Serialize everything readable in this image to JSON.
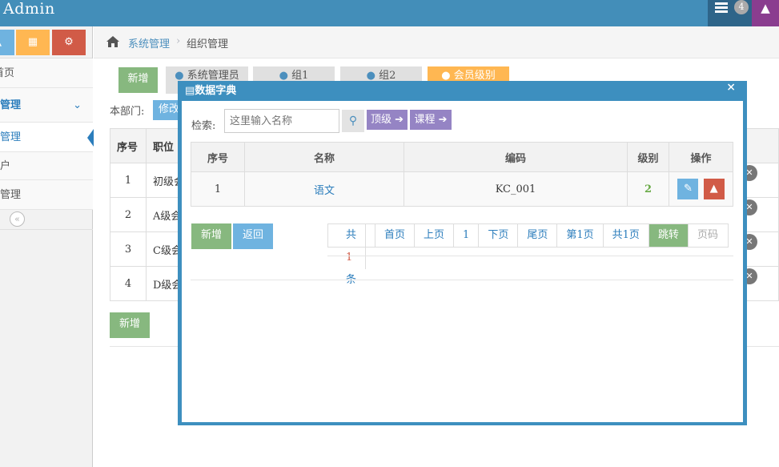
{
  "app": {
    "title": "Admin",
    "notification_count": "4"
  },
  "colors": {
    "navbar": "#438eb9",
    "overlay": "#3d8fbf",
    "green": "#87b87f",
    "blue": "#6fb3e0",
    "red": "#d15b47",
    "purple": "#9584c4",
    "yellow": "#ffb752"
  },
  "sidebar": {
    "shortcut_icons": [
      "chart-icon",
      "book-icon",
      "cogs-icon"
    ],
    "items": [
      {
        "label": "首页"
      },
      {
        "label": "管理"
      },
      {
        "label": "管理"
      },
      {
        "label": "户"
      },
      {
        "label": "管理"
      }
    ]
  },
  "breadcrumb": {
    "root": "系统管理",
    "current": "组织管理"
  },
  "page": {
    "add_label": "新增",
    "tabs": [
      "系统管理员",
      "组1",
      "组2",
      "会员级别"
    ],
    "dept_label": "本部门:",
    "edit_label": "修改",
    "table_headers": [
      "序号",
      "职位"
    ],
    "rows": [
      {
        "no": "1",
        "title": "初级会"
      },
      {
        "no": "2",
        "title": "A级会"
      },
      {
        "no": "3",
        "title": "C级会"
      },
      {
        "no": "4",
        "title": "D级会"
      }
    ],
    "bottom_add_label": "新增"
  },
  "modal": {
    "title": "数据字典",
    "close": "×",
    "search_label": "检索:",
    "search_placeholder": "这里输入名称",
    "btn_top": "顶级",
    "btn_course": "课程",
    "headers": [
      "序号",
      "名称",
      "编码",
      "级别",
      "操作"
    ],
    "rows": [
      {
        "no": "1",
        "name": "语文",
        "code": "KC_001",
        "level": "2"
      }
    ],
    "add_label": "新增",
    "back_label": "返回",
    "pager": {
      "total_prefix": "共",
      "total_count": "1",
      "total_suffix": "条",
      "first": "首页",
      "prev": "上页",
      "current": "1",
      "next": "下页",
      "last": "尾页",
      "page_of": "第1页",
      "pages_total": "共1页",
      "jump": "跳转",
      "page_input_placeholder": "页码"
    }
  }
}
